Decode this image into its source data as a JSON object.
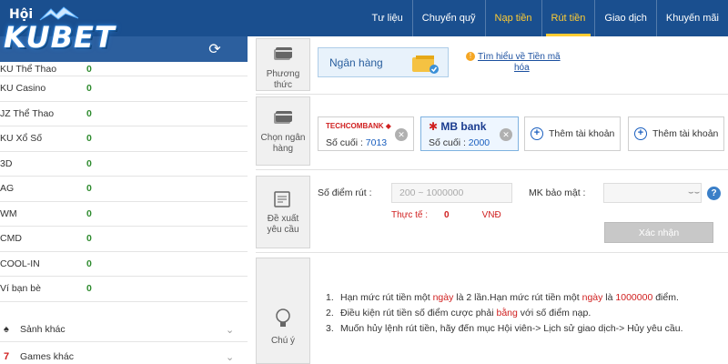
{
  "logo": {
    "small": "Hội",
    "big": "KUBET"
  },
  "nav": [
    {
      "label": "Tư liệu"
    },
    {
      "label": "Chuyển quỹ"
    },
    {
      "label": "Nạp tiền"
    },
    {
      "label": "Rút tiền"
    },
    {
      "label": "Giao dịch"
    },
    {
      "label": "Khuyến mãi"
    }
  ],
  "games": [
    {
      "name": "KU Thể Thao",
      "value": "0"
    },
    {
      "name": "KU Casino",
      "value": "0"
    },
    {
      "name": "JZ Thể Thao",
      "value": "0"
    },
    {
      "name": "KU Xổ Số",
      "value": "0"
    },
    {
      "name": "3D",
      "value": "0"
    },
    {
      "name": "AG",
      "value": "0"
    },
    {
      "name": "WM",
      "value": "0"
    },
    {
      "name": "CMD",
      "value": "0"
    },
    {
      "name": "COOL-IN",
      "value": "0"
    },
    {
      "name": "Ví bạn bè",
      "value": "0"
    }
  ],
  "groups": [
    {
      "label": "Sảnh khác",
      "icon": "spade-icon"
    },
    {
      "label": "Games khác",
      "icon": "seven-icon"
    }
  ],
  "sections": {
    "method": "Phương thức",
    "bank": "Chọn ngân hàng",
    "request": "Đề xuất yêu cầu",
    "note": "Chú ý"
  },
  "method_option": "Ngân hàng",
  "info_link": {
    "line1": "Tìm hiểu về Tiền mã",
    "line2": "hóa"
  },
  "banks": [
    {
      "name": "TECHCOMBANK",
      "last_label": "Số cuối :",
      "last": "7013"
    },
    {
      "name": "MB bank",
      "last_label": "Số cuối :",
      "last": "2000"
    }
  ],
  "add_account": "Thêm tài khoản",
  "form": {
    "points_label": "Số điểm rút :",
    "points_placeholder": "200 ~ 1000000",
    "actual_label": "Thực tế :",
    "actual_value": "0",
    "actual_unit": "VNĐ",
    "password_label": "MK bảo mật :",
    "confirm": "Xác nhận"
  },
  "notes": [
    {
      "num": "1.",
      "parts": [
        "Hạn mức rút tiền một ",
        "ngày",
        " là 2 lần.Hạn mức rút tiền một ",
        "ngày",
        " là ",
        "1000000",
        " điểm."
      ]
    },
    {
      "num": "2.",
      "parts": [
        "Điều kiện rút tiền số điểm cược phải ",
        "bằng",
        " với số điểm nạp."
      ]
    },
    {
      "num": "3.",
      "parts": [
        "Muốn hủy lệnh rút tiền, hãy đến mục Hội viên-> Lịch sử giao dịch-> Hủy yêu cầu."
      ]
    }
  ],
  "colors": {
    "nav_bg": "#1a4f8f",
    "accent": "#ffcc33",
    "value_green": "#2e8b2e",
    "alert_red": "#d02020"
  }
}
